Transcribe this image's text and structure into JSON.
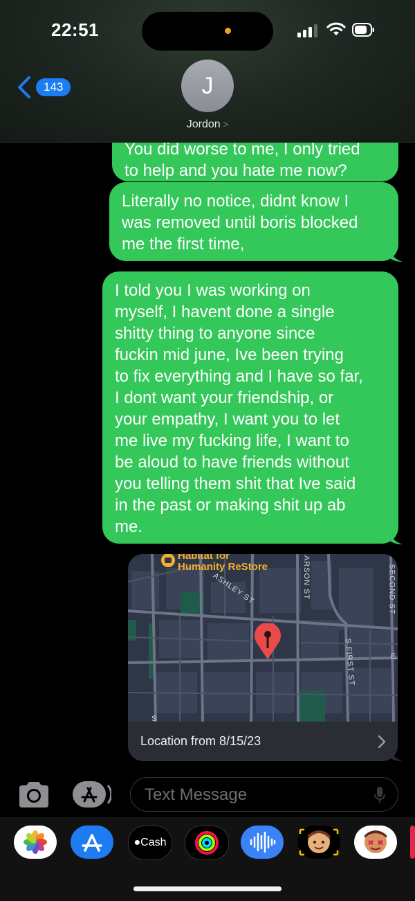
{
  "status": {
    "time": "22:51"
  },
  "header": {
    "back_count": "143",
    "avatar_initial": "J",
    "contact_name": "Jordon",
    "contact_chevron": ">"
  },
  "messages": [
    {
      "text": "You did worse to me, I only tried\nto help and you hate me now?"
    },
    {
      "text": "Literally no notice, didnt know I\nwas removed until boris blocked\nme the first time,"
    },
    {
      "text": "I told you I was working on\nmyself, I havent done a single\nshitty thing to anyone since\nfuckin mid june, Ive been trying\nto fix everything and I have so far,\nI dont want your friendship, or\nyour empathy, I want you to let\nme live my fucking life, I want to\nbe aloud to have friends without\nyou telling them shit that Ive said\nin the past or making shit up ab\nme."
    }
  ],
  "location": {
    "poi_line1": "Habitat for",
    "poi_line2": "Humanity ReStore",
    "streets": [
      "ASHLEY ST",
      "ARSON ST",
      "S FIRST ST",
      "SECOND ST",
      "E",
      "S"
    ],
    "footer": "Location from 8/15/23"
  },
  "input": {
    "placeholder": "Text Message"
  },
  "apps": [
    {
      "name": "Photos"
    },
    {
      "name": "App Store"
    },
    {
      "name": "Cash",
      "label": "Cash"
    },
    {
      "name": "Fitness"
    },
    {
      "name": "Audio"
    },
    {
      "name": "Memoji"
    },
    {
      "name": "Stickers"
    }
  ],
  "colors": {
    "bubble": "#34c759",
    "badge": "#1c7cf2",
    "background": "#000000"
  }
}
